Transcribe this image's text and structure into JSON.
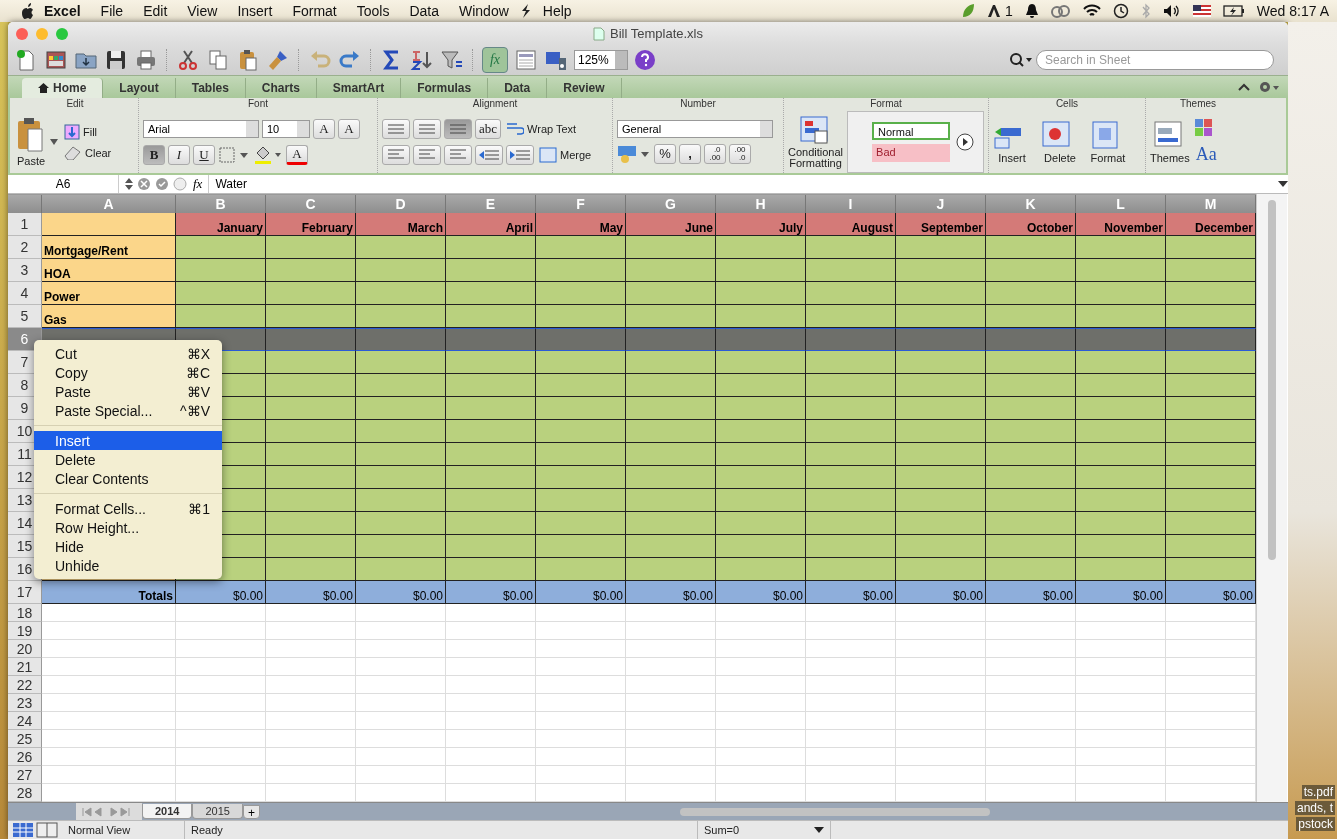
{
  "menubar": {
    "app": "Excel",
    "items": [
      "File",
      "Edit",
      "View",
      "Insert",
      "Format",
      "Tools",
      "Data",
      "Window"
    ],
    "help": "Help",
    "adobe_count": "1",
    "clock": "Wed 8:17 A"
  },
  "window": {
    "title": "Bill Template.xls"
  },
  "toolbar": {
    "fx": "fx",
    "formula_builder_on": true,
    "zoom": "125%",
    "search": {
      "placeholder": "Search in Sheet"
    }
  },
  "ribbon_tabs": [
    {
      "label": "Home",
      "selected": true
    },
    {
      "label": "Layout",
      "selected": false
    },
    {
      "label": "Tables",
      "selected": false
    },
    {
      "label": "Charts",
      "selected": false
    },
    {
      "label": "SmartArt",
      "selected": false
    },
    {
      "label": "Formulas",
      "selected": false
    },
    {
      "label": "Data",
      "selected": false
    },
    {
      "label": "Review",
      "selected": false
    }
  ],
  "ribbon": {
    "edit": {
      "title": "Edit",
      "paste": "Paste",
      "fill": "Fill",
      "clear": "Clear"
    },
    "font": {
      "title": "Font",
      "family": "Arial",
      "size": "10",
      "grow": "A",
      "shrink": "A",
      "bold": {
        "label": "B",
        "on": true
      },
      "italic": {
        "label": "I",
        "on": false
      },
      "underline": {
        "label": "U",
        "on": false
      },
      "color_letter": "A"
    },
    "alignment": {
      "title": "Alignment",
      "valign": [
        {
          "selected": false
        },
        {
          "selected": false
        },
        {
          "selected": true
        }
      ],
      "orientation": "abc",
      "wrap": "Wrap Text",
      "merge": "Merge"
    },
    "number": {
      "title": "Number",
      "format": "General",
      "percent": "%",
      "comma": ",",
      "decimals": [
        {
          "top": ".0",
          "bottom": ".00"
        },
        {
          "top": ".00",
          "bottom": ".0"
        }
      ]
    },
    "format": {
      "title": "Format",
      "conditional": "Conditional Formatting",
      "styles": [
        {
          "label": "Normal",
          "kind": "normal"
        },
        {
          "label": "Bad",
          "kind": "bad"
        }
      ]
    },
    "cells": {
      "title": "Cells",
      "buttons": [
        "Insert",
        "Delete",
        "Format"
      ]
    },
    "themes": {
      "title": "Themes",
      "button": "Themes",
      "fonts": "Aa"
    }
  },
  "formula_bar": {
    "cell": "A6",
    "fx": "fx",
    "formula": "Water"
  },
  "sheet": {
    "columns": [
      "A",
      "B",
      "C",
      "D",
      "E",
      "F",
      "G",
      "H",
      "I",
      "J",
      "K",
      "L",
      "M"
    ],
    "rows": [
      {
        "number": "1",
        "kind": "header",
        "selected": false,
        "cells": [
          "",
          "January",
          "February",
          "March",
          "April",
          "May",
          "June",
          "July",
          "August",
          "September",
          "October",
          "November",
          "December"
        ]
      },
      {
        "number": "2",
        "kind": "item",
        "selected": false,
        "label": "Mortgage/Rent"
      },
      {
        "number": "3",
        "kind": "item",
        "selected": false,
        "label": "HOA"
      },
      {
        "number": "4",
        "kind": "item",
        "selected": false,
        "label": "Power"
      },
      {
        "number": "5",
        "kind": "item",
        "selected": false,
        "label": "Gas"
      },
      {
        "number": "6",
        "kind": "item",
        "selected": true
      },
      {
        "number": "7",
        "kind": "item",
        "selected": false
      },
      {
        "number": "8",
        "kind": "item",
        "selected": false
      },
      {
        "number": "9",
        "kind": "item",
        "selected": false
      },
      {
        "number": "10",
        "kind": "item",
        "selected": false
      },
      {
        "number": "11",
        "kind": "item",
        "selected": false
      },
      {
        "number": "12",
        "kind": "item",
        "selected": false
      },
      {
        "number": "13",
        "kind": "item",
        "selected": false
      },
      {
        "number": "14",
        "kind": "item",
        "selected": false
      },
      {
        "number": "15",
        "kind": "item",
        "selected": false
      },
      {
        "number": "16",
        "kind": "item",
        "selected": false
      },
      {
        "number": "17",
        "kind": "totals",
        "selected": false,
        "cells": [
          "Totals",
          "$0.00",
          "$0.00",
          "$0.00",
          "$0.00",
          "$0.00",
          "$0.00",
          "$0.00",
          "$0.00",
          "$0.00",
          "$0.00",
          "$0.00",
          "$0.00"
        ]
      },
      {
        "number": "18",
        "kind": "blank",
        "selected": false
      },
      {
        "number": "19",
        "kind": "blank",
        "selected": false
      },
      {
        "number": "20",
        "kind": "blank",
        "selected": false
      },
      {
        "number": "21",
        "kind": "blank",
        "selected": false
      },
      {
        "number": "22",
        "kind": "blank",
        "selected": false
      },
      {
        "number": "23",
        "kind": "blank",
        "selected": false
      },
      {
        "number": "24",
        "kind": "blank",
        "selected": false
      },
      {
        "number": "25",
        "kind": "blank",
        "selected": false
      },
      {
        "number": "26",
        "kind": "blank",
        "selected": false
      },
      {
        "number": "27",
        "kind": "blank",
        "selected": false
      },
      {
        "number": "28",
        "kind": "blank",
        "selected": false
      }
    ]
  },
  "context_menu": {
    "sections": [
      [
        {
          "label": "Cut",
          "shortcut": "⌘X",
          "selected": false
        },
        {
          "label": "Copy",
          "shortcut": "⌘C",
          "selected": false
        },
        {
          "label": "Paste",
          "shortcut": "⌘V",
          "selected": false
        },
        {
          "label": "Paste Special...",
          "shortcut": "^⌘V",
          "selected": false
        }
      ],
      [
        {
          "label": "Insert",
          "selected": true
        },
        {
          "label": "Delete",
          "selected": false
        },
        {
          "label": "Clear Contents",
          "selected": false
        }
      ],
      [
        {
          "label": "Format Cells...",
          "shortcut": "⌘1",
          "selected": false
        },
        {
          "label": "Row Height...",
          "selected": false
        },
        {
          "label": "Hide",
          "selected": false
        },
        {
          "label": "Unhide",
          "selected": false
        }
      ]
    ]
  },
  "sheet_tabs": [
    {
      "label": "2014",
      "selected": true
    },
    {
      "label": "2015",
      "selected": false
    }
  ],
  "add_sheet": "+",
  "status_bar": {
    "view": "Normal View",
    "state": "Ready",
    "sum": "Sum=0"
  },
  "desktop_labels": [
    "ts.pdf",
    "ands, t",
    "pstock"
  ]
}
